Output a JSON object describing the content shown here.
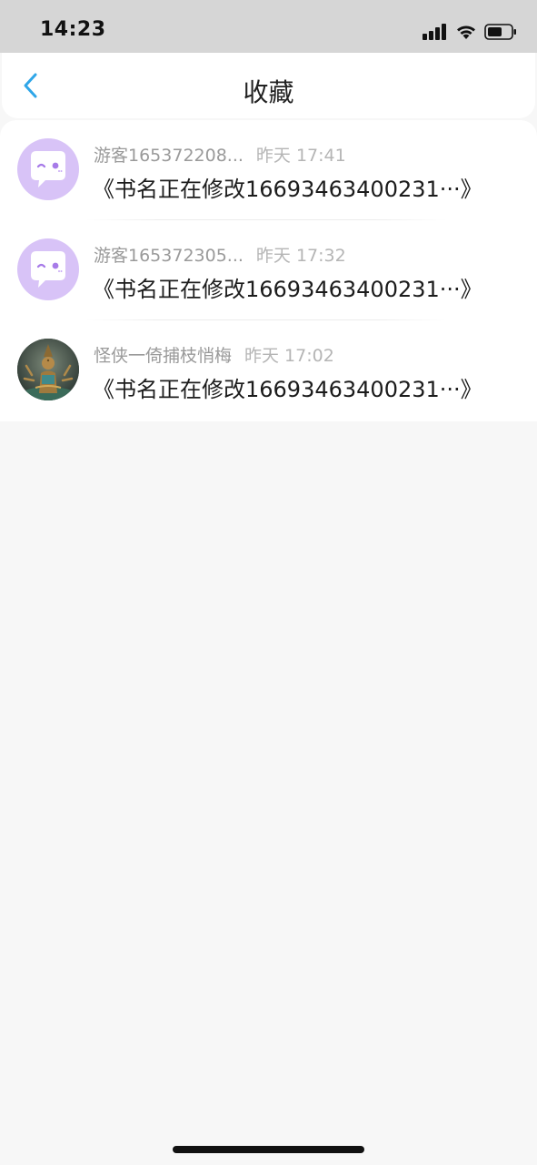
{
  "status_bar": {
    "time": "14:23"
  },
  "header": {
    "title": "收藏",
    "back_icon": "chevron-left-icon"
  },
  "colors": {
    "accent": "#2fa6e8",
    "avatar_default_bg": "#d8c3f7",
    "avatar_default_fg": "#a77be8"
  },
  "items": [
    {
      "user": "游客165372208...",
      "time": "昨天 17:41",
      "title": "《书名正在修改16693463400231···》",
      "avatar": "chat-bubble-avatar"
    },
    {
      "user": "游客165372305...",
      "time": "昨天 17:32",
      "title": "《书名正在修改16693463400231···》",
      "avatar": "chat-bubble-avatar"
    },
    {
      "user": "怪侠一倚捕枝悄梅",
      "time": "昨天 17:02",
      "title": "《书名正在修改16693463400231···》",
      "avatar": "statue-photo-avatar"
    }
  ]
}
